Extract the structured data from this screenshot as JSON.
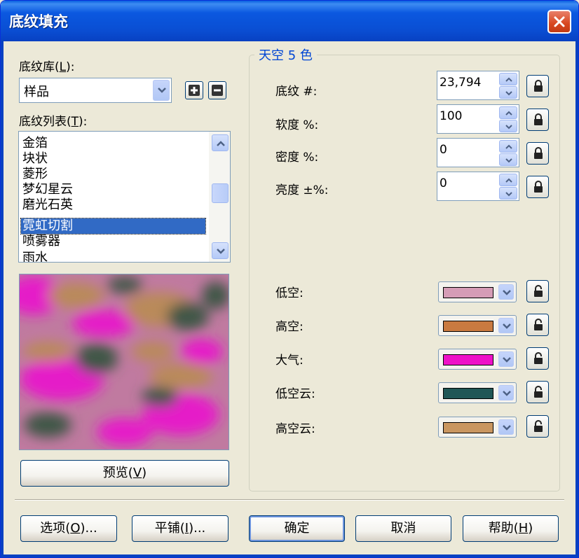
{
  "window": {
    "title": "底纹填充"
  },
  "library": {
    "label": "底纹库(",
    "label_key": "L",
    "label_end": "):",
    "selected": "样品"
  },
  "texture_list": {
    "label": "底纹列表(",
    "label_key": "T",
    "label_end": "):",
    "items": [
      {
        "label": "金箔"
      },
      {
        "label": "块状"
      },
      {
        "label": "菱形"
      },
      {
        "label": "梦幻星云"
      },
      {
        "label": "磨光石英"
      },
      {
        "label": "霓虹切割"
      },
      {
        "label": "喷雾器"
      },
      {
        "label": "雨水"
      }
    ],
    "selected_index": 5
  },
  "preview_button": {
    "label": "预览(",
    "key": "V",
    "end": ")"
  },
  "group": {
    "title": "天空 5 色",
    "params": [
      {
        "label": "底纹 #:",
        "value": "23,794"
      },
      {
        "label": "软度 %:",
        "value": "100"
      },
      {
        "label": "密度 %:",
        "value": "0"
      },
      {
        "label": "亮度 ±%:",
        "value": "0"
      }
    ],
    "colors": [
      {
        "label": "低空:",
        "color": "#d59cb6"
      },
      {
        "label": "高空:",
        "color": "#c97a40"
      },
      {
        "label": "大气:",
        "color": "#ee10c8"
      },
      {
        "label": "低空云:",
        "color": "#1f5656"
      },
      {
        "label": "高空云:",
        "color": "#c99660"
      }
    ]
  },
  "buttons": {
    "options": {
      "label": "选项(",
      "key": "O",
      "end": ")..."
    },
    "tile": {
      "label": "平铺(",
      "key": "I",
      "end": ")..."
    },
    "ok": {
      "label": "确定"
    },
    "cancel": {
      "label": "取消"
    },
    "help": {
      "label": "帮助(",
      "key": "H",
      "end": ")"
    }
  },
  "preview_colors": {
    "base": "#c07aa0",
    "magenta": "#e51ac8",
    "tan": "#b98a5a",
    "darkgreen": "#3f5746"
  }
}
